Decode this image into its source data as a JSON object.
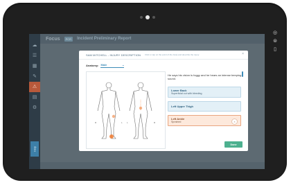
{
  "app": {
    "logo": "Focus",
    "logo_badge": "PCR",
    "page_title": "Incident Preliminary Report"
  },
  "sidebar": {
    "items": [
      {
        "icon": "cloud-icon"
      },
      {
        "icon": "list-icon"
      },
      {
        "icon": "calendar-icon"
      },
      {
        "icon": "wrench-icon"
      },
      {
        "icon": "alert-icon",
        "active": true
      },
      {
        "icon": "chart-icon"
      },
      {
        "icon": "gear-icon"
      }
    ],
    "help_label": "Help"
  },
  "modal": {
    "title": "SAM MITCHELL - INJURY DESCRIPTION",
    "hint": "Click or tap on the point of the body and describe the injury",
    "close_glyph": "×",
    "anatomy_label": "Anatomy:",
    "anatomy_value": "Male",
    "figure_labels": [
      "R",
      "L",
      "L",
      "R"
    ],
    "notes": "He says his vision is foggy and he hears an intense beeping sound.",
    "injuries": [
      {
        "name": "Lower Back",
        "description": "Superficial cut with bleeding",
        "selected": false
      },
      {
        "name": "Left Upper Thigh",
        "description": "",
        "selected": false
      },
      {
        "name": "Left Ankle",
        "description": "Sprained",
        "selected": true
      }
    ],
    "remove_glyph": "×",
    "done_label": "Done"
  },
  "colors": {
    "accent": "#3d8bb8",
    "done": "#4db08f",
    "injury_marker": "#f07a2f",
    "selected_card": "#fde9dc"
  }
}
